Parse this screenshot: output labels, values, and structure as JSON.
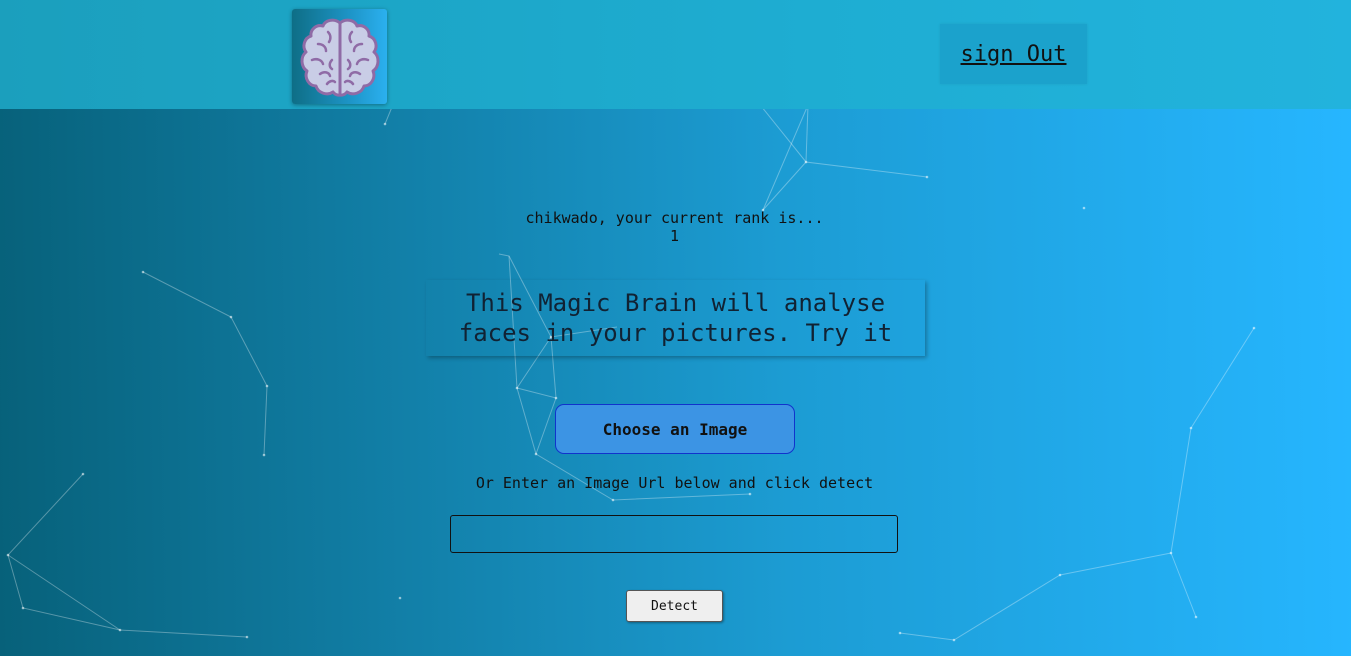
{
  "navigation": {
    "logo_icon": "brain-icon",
    "sign_out_label": "sign Out"
  },
  "rank": {
    "message": "chikwado, your current rank is...",
    "value": "1"
  },
  "intro": {
    "text": "This Magic Brain will analyse faces in your pictures. Try it"
  },
  "upload": {
    "choose_label": "Choose an Image",
    "or_text": "Or Enter an Image Url below and click detect",
    "url_value": "",
    "detect_label": "Detect"
  },
  "colors": {
    "background_start": "#07617a",
    "background_end": "#26b6ff",
    "choose_button": "#3c94e4",
    "brain": "#c9cde6",
    "brain_outline": "#8f6ba6"
  }
}
